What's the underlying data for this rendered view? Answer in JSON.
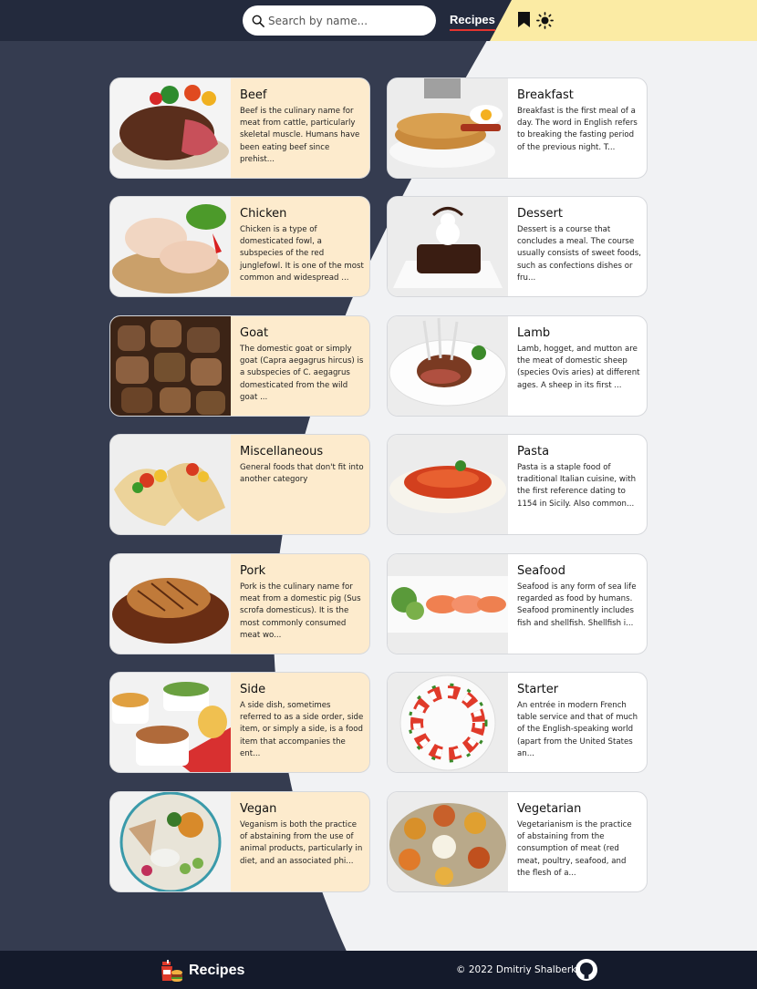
{
  "header": {
    "search_placeholder": "Search by name...",
    "nav_label": "Recipes",
    "icons": [
      "search-icon",
      "bookmark-icon",
      "sun-icon"
    ]
  },
  "colors": {
    "dark_bg": "#353c50",
    "light_bg": "#f1f2f4",
    "header_dark": "#232a3d",
    "header_yellow": "#fbeba4",
    "warm_card": "#fdebcd",
    "accent_underline": "#e3342f"
  },
  "categories": [
    {
      "title": "Beef",
      "description": "Beef is the culinary name for meat from cattle, particularly skeletal muscle. Humans have been eating beef since prehist..."
    },
    {
      "title": "Breakfast",
      "description": "Breakfast is the first meal of a day. The word in English refers to breaking the fasting period of the previous night. T..."
    },
    {
      "title": "Chicken",
      "description": "Chicken is a type of domesticated fowl, a subspecies of the red junglefowl. It is one of the most common and widespread ..."
    },
    {
      "title": "Dessert",
      "description": "Dessert is a course that concludes a meal. The course usually consists of sweet foods, such as confections dishes or fru..."
    },
    {
      "title": "Goat",
      "description": "The domestic goat or simply goat (Capra aegagrus hircus) is a subspecies of C. aegagrus domesticated from the wild goat ..."
    },
    {
      "title": "Lamb",
      "description": "Lamb, hogget, and mutton are the meat of domestic sheep (species Ovis aries) at different ages. A sheep in its first ..."
    },
    {
      "title": "Miscellaneous",
      "description": "General foods that don't fit into another category"
    },
    {
      "title": "Pasta",
      "description": "Pasta is a staple food of traditional Italian cuisine, with the first reference dating to 1154 in Sicily. Also common..."
    },
    {
      "title": "Pork",
      "description": "Pork is the culinary name for meat from a domestic pig (Sus scrofa domesticus). It is the most commonly consumed meat wo..."
    },
    {
      "title": "Seafood",
      "description": "Seafood is any form of sea life regarded as food by humans. Seafood prominently includes fish and shellfish. Shellfish i..."
    },
    {
      "title": "Side",
      "description": "A side dish, sometimes referred to as a side order, side item, or simply a side, is a food item that accompanies the ent..."
    },
    {
      "title": "Starter",
      "description": "An entrée in modern French table service and that of much of the English-speaking world (apart from the United States an..."
    },
    {
      "title": "Vegan",
      "description": "Veganism is both the practice of abstaining from the use of animal products, particularly in diet, and an associated phi..."
    },
    {
      "title": "Vegetarian",
      "description": "Vegetarianism is the practice of abstaining from the consumption of meat (red meat, poultry, seafood, and the flesh of a..."
    }
  ],
  "footer": {
    "title": "Recipes",
    "copyright": "© 2022 Dmitriy Shalberkin",
    "icons": [
      "recipes-logo-icon",
      "github-icon"
    ]
  }
}
